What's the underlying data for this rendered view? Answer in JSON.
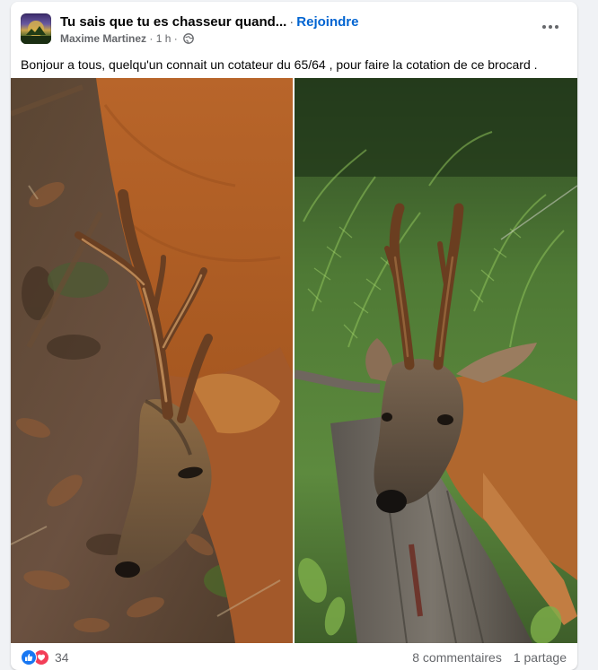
{
  "post": {
    "group_name": "Tu sais que tu es chasseur quand...",
    "separator": "·",
    "join_label": "Rejoindre",
    "author": "Maxime Martinez",
    "time": "1 h",
    "audience_icon": "globe-icon",
    "more_icon": "more-options-icon",
    "text": "Bonjour a tous, quelqu'un connait un cotateur du 65/64 , pour faire la cotation de ce brocard .",
    "photos": [
      {
        "icon": "roe-deer-photo-left"
      },
      {
        "icon": "roe-deer-photo-right"
      }
    ],
    "reactions": {
      "icons": [
        "like-icon",
        "love-icon"
      ],
      "count": "34"
    },
    "comments": "8 commentaires",
    "shares": "1 partage"
  },
  "colors": {
    "link_blue": "#0064d1",
    "like_blue": "#1877f2",
    "love_red": "#f33e58",
    "secondary_text": "#65676b",
    "page_bg": "#f0f2f5"
  }
}
